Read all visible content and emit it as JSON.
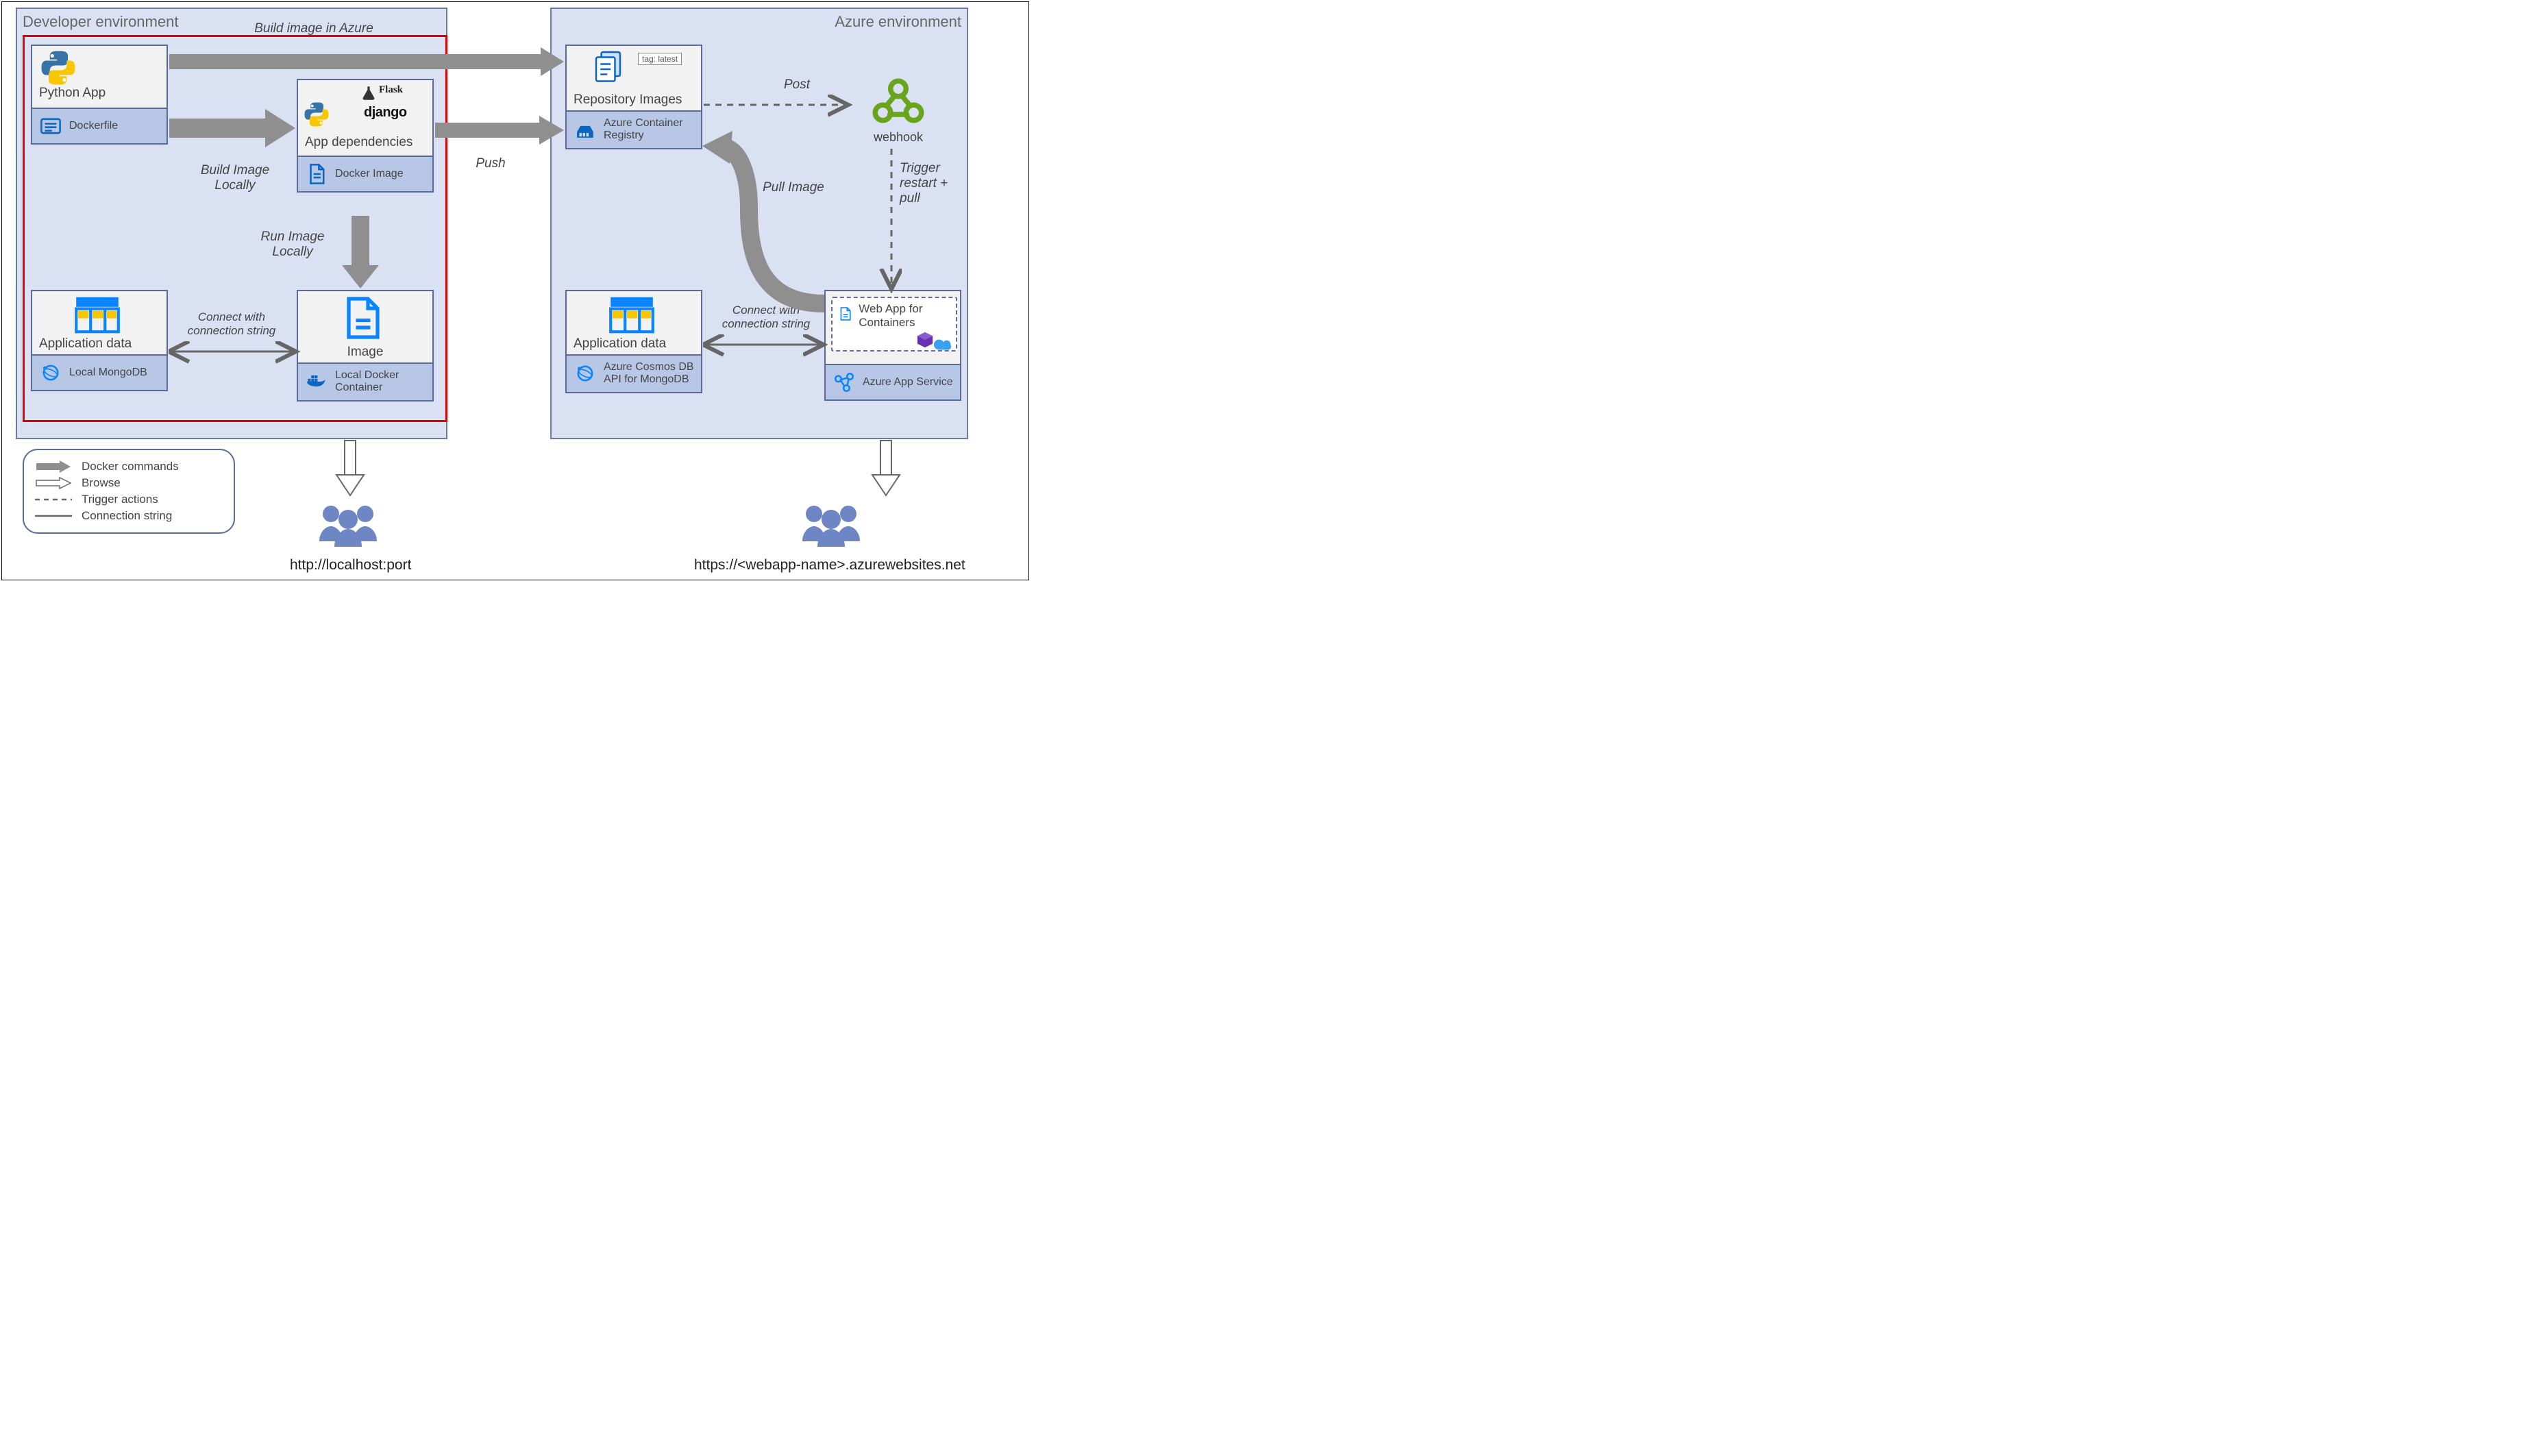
{
  "env": {
    "dev": "Developer environment",
    "azure": "Azure environment"
  },
  "cards": {
    "python_app": {
      "title": "Python App",
      "footer": "Dockerfile"
    },
    "app_deps": {
      "title": "App dependencies",
      "footer": "Docker Image",
      "frameworks": {
        "flask": "Flask",
        "django": "django"
      }
    },
    "image": {
      "title": "Image",
      "footer": "Local Docker Container"
    },
    "app_data_dev": {
      "title": "Application data",
      "footer": "Local MongoDB"
    },
    "repo_images": {
      "title": "Repository Images",
      "footer": "Azure Container Registry",
      "tag": "tag: latest"
    },
    "app_data_az": {
      "title": "Application data",
      "footer": "Azure Cosmos DB API for MongoDB"
    },
    "webapp": {
      "inner": "Web App for Containers",
      "footer": "Azure App Service"
    },
    "webhook": {
      "label": "webhook"
    }
  },
  "annotations": {
    "build_in_azure": "Build image in Azure",
    "build_locally": "Build Image Locally",
    "run_locally": "Run Image Locally",
    "conn_dev": "Connect with connection string",
    "push": "Push",
    "post": "Post",
    "pull_image": "Pull Image",
    "trigger": "Trigger restart + pull",
    "conn_az": "Connect with connection string"
  },
  "legend": {
    "docker_cmds": "Docker commands",
    "browse": "Browse",
    "trigger": "Trigger actions",
    "conn": "Connection string"
  },
  "urls": {
    "local": "http://localhost:port",
    "azure": "https://<webapp-name>.azurewebsites.net"
  }
}
